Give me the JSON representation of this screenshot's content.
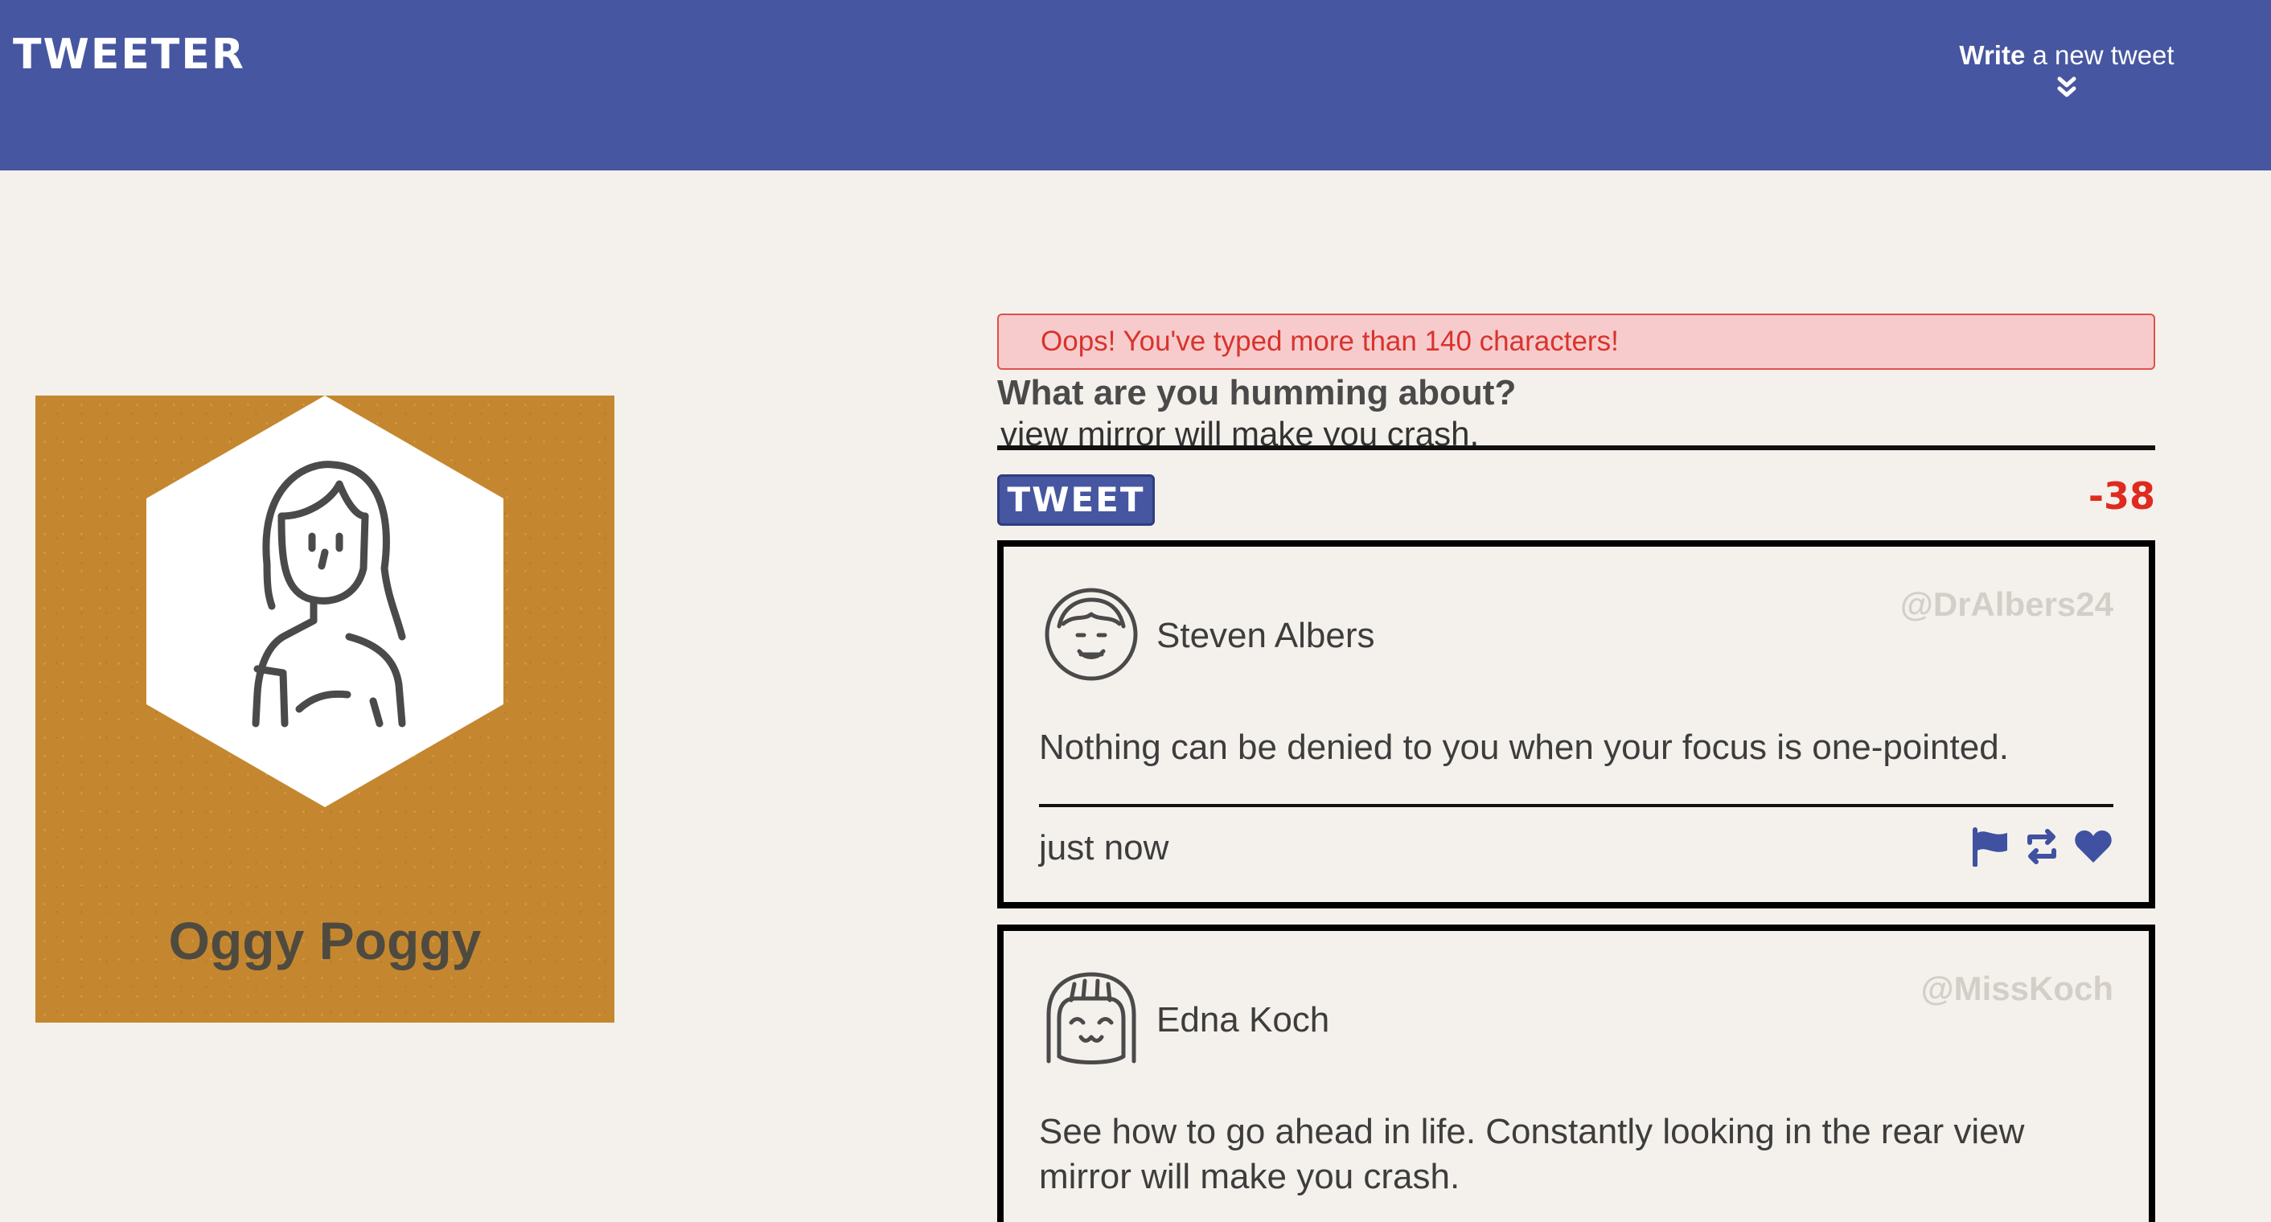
{
  "nav": {
    "brand": "TWEETER",
    "compose_toggle": {
      "bold": "Write",
      "rest": " a new tweet"
    }
  },
  "profile": {
    "name": "Oggy Poggy",
    "background_color": "#c4872f"
  },
  "compose": {
    "error": "Oops! You've typed more than 140 characters!",
    "label": "What are you humming about?",
    "typed_text": "view mirror will make you crash.",
    "submit_label": "TWEET",
    "counter": "-38"
  },
  "tweets": [
    {
      "name": "Steven Albers",
      "handle": "@DrAlbers24",
      "text": "Nothing can be denied to you when your focus is one-pointed.",
      "time": "just now",
      "actions": [
        "flag-icon",
        "retweet-icon",
        "heart-icon"
      ]
    },
    {
      "name": "Edna Koch",
      "handle": "@MissKoch",
      "text": "See how to go ahead in life. Constantly looking in the rear view mirror will make you crash."
    }
  ],
  "colors": {
    "nav": "#4656a0",
    "error_bg": "#f7cbcb",
    "error_text": "#d8332e",
    "counter": "#e02a1f",
    "page_bg": "#f4f1ec"
  }
}
